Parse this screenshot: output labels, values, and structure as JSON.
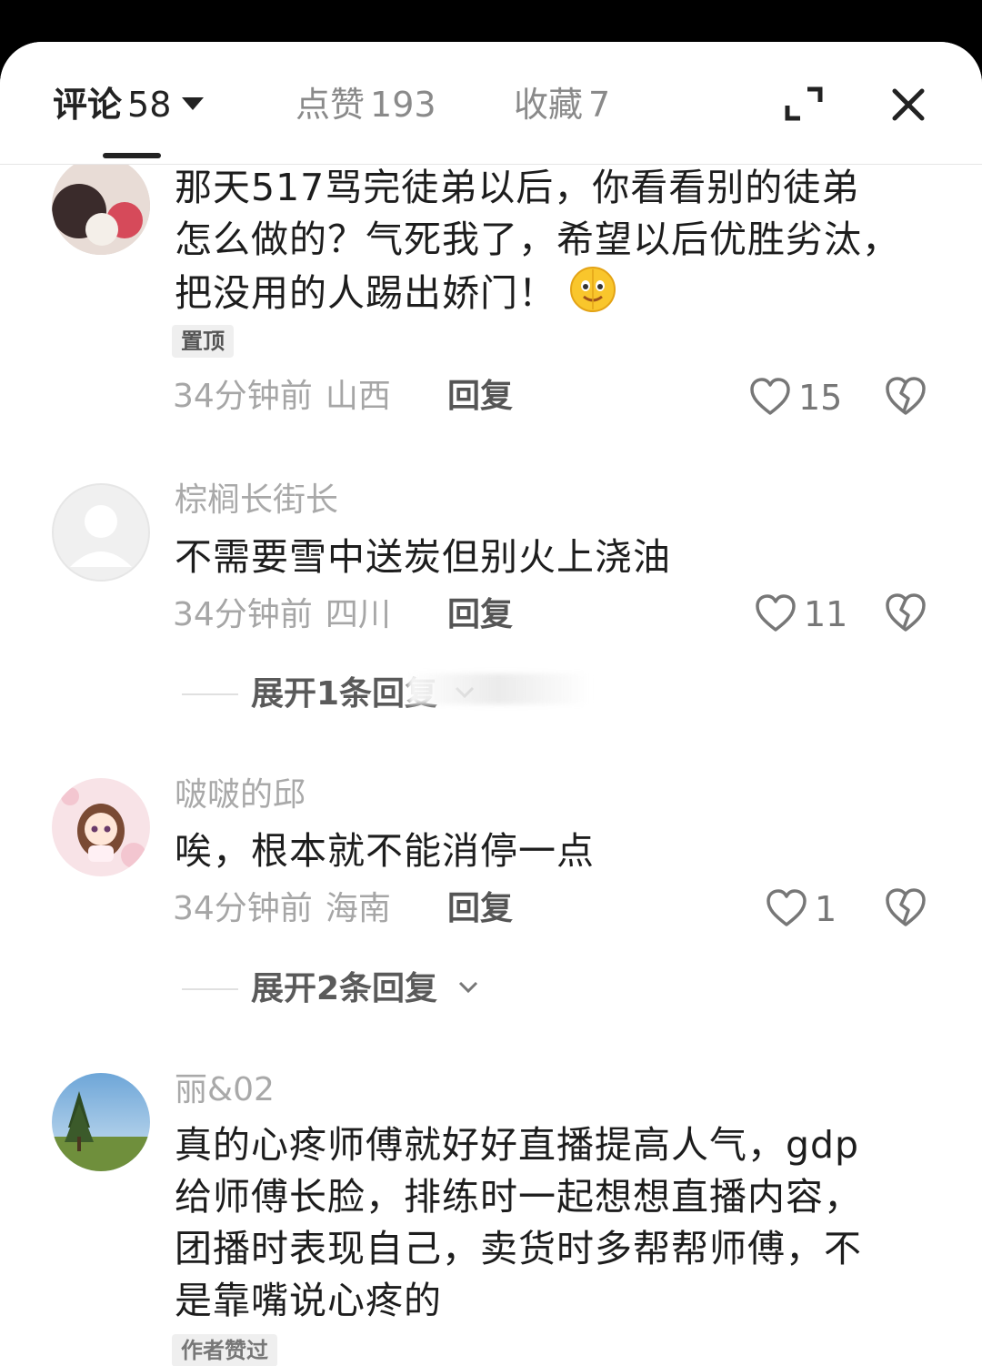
{
  "header": {
    "tabs": [
      {
        "label": "评论",
        "count": "58"
      },
      {
        "label": "点赞",
        "count": "193"
      },
      {
        "label": "收藏",
        "count": "7"
      }
    ]
  },
  "comments": [
    {
      "text_lines": [
        "那天517骂完徒弟以后，你看看别的徒弟",
        "怎么做的？气死我了，希望以后优胜劣汰，",
        "把没用的人踢出娇门！"
      ],
      "badge": "置顶",
      "time": "34分钟前",
      "location": "山西",
      "reply": "回复",
      "likes": "15"
    },
    {
      "username": "棕榈长街长",
      "text_lines": [
        "不需要雪中送炭但别火上浇油"
      ],
      "time": "34分钟前",
      "location": "四川",
      "reply": "回复",
      "likes": "11",
      "expand": "展开1条回复"
    },
    {
      "username": "啵啵的邱",
      "text_lines": [
        "唉，根本就不能消停一点"
      ],
      "time": "34分钟前",
      "location": "海南",
      "reply": "回复",
      "likes": "1",
      "expand": "展开2条回复"
    },
    {
      "username": "丽&02",
      "text_lines": [
        "真的心疼师傅就好好直播提高人气，gdp",
        "给师傅长脸，排练时一起想想直播内容，",
        "团播时表现自己，卖货时多帮帮师傅，不",
        "是靠嘴说心疼的"
      ],
      "badge": "作者赞过"
    }
  ]
}
